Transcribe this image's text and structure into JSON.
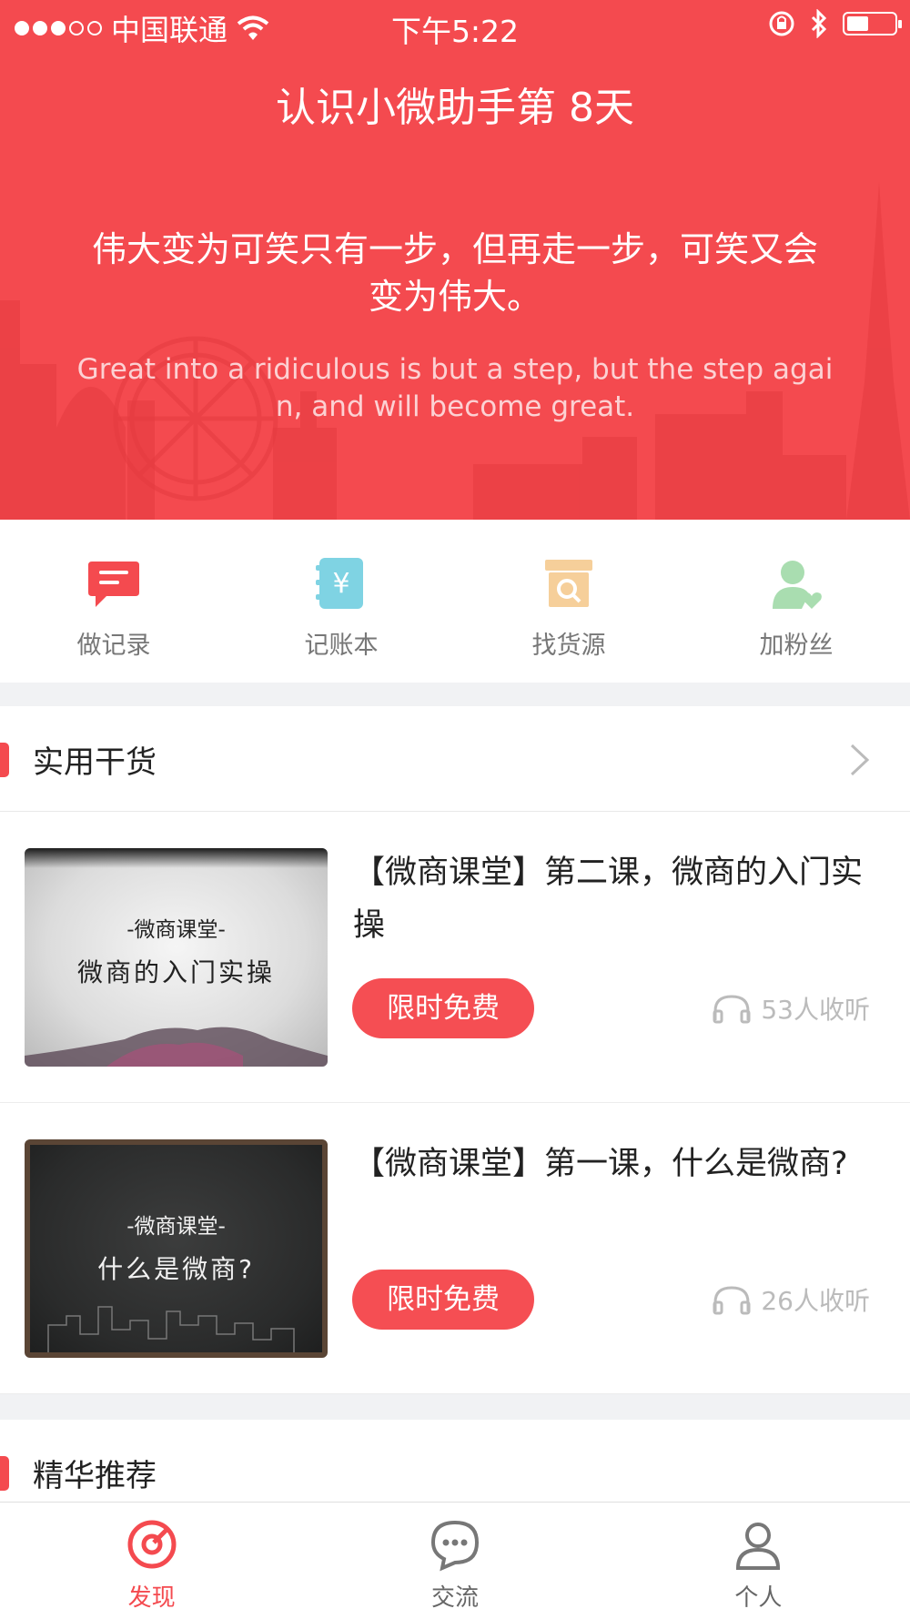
{
  "colors": {
    "accent": "#f44a4f",
    "hero_bg": "#f44a4f",
    "muted": "#bbbbbb"
  },
  "status_bar": {
    "carrier": "中国联通",
    "time": "下午5:22",
    "signal_bars_filled": 3,
    "signal_bars_total": 5,
    "battery_level": 0.45
  },
  "hero": {
    "title": "认识小微助手第 8天",
    "quote_cn": "伟大变为可笑只有一步，但再走一步，可笑又会变为伟大。",
    "quote_en": "Great into a ridiculous is but a step, but the step again, and will become great."
  },
  "quick_actions": [
    {
      "label": "做记录",
      "icon": "note-icon",
      "color": "#f44a4f"
    },
    {
      "label": "记账本",
      "icon": "yen-ledger-icon",
      "color": "#7fd3e3"
    },
    {
      "label": "找货源",
      "icon": "search-box-icon",
      "color": "#f6cf9a"
    },
    {
      "label": "加粉丝",
      "icon": "add-fans-icon",
      "color": "#a9ddb0"
    }
  ],
  "sections": {
    "practical": {
      "title": "实用干货",
      "courses": [
        {
          "thumb_subtitle": "-微商课堂-",
          "thumb_title": "微商的入门实操",
          "title": "【微商课堂】第二课，微商的入门实操",
          "badge": "限时免费",
          "listeners": "53人收听"
        },
        {
          "thumb_subtitle": "-微商课堂-",
          "thumb_title": "什么是微商?",
          "title": "【微商课堂】第一课，什么是微商?",
          "badge": "限时免费",
          "listeners": "26人收听"
        }
      ]
    },
    "featured": {
      "title": "精华推荐"
    }
  },
  "tab_bar": [
    {
      "label": "发现",
      "icon": "discover-icon",
      "active": true
    },
    {
      "label": "交流",
      "icon": "chat-icon",
      "active": false
    },
    {
      "label": "个人",
      "icon": "profile-icon",
      "active": false
    }
  ]
}
